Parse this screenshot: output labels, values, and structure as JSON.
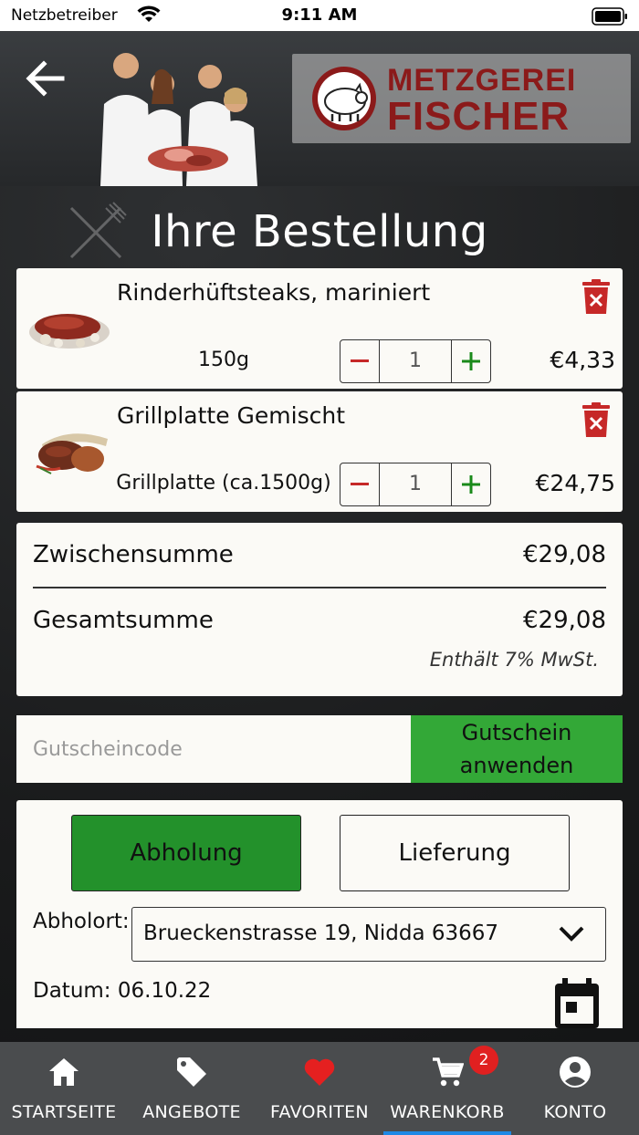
{
  "status_bar": {
    "carrier": "Netzbetreiber",
    "time": "9:11 AM"
  },
  "header": {
    "brand_line1": "METZGEREI",
    "brand_line2": "FISCHER"
  },
  "page_title": "Ihre Bestellung",
  "cart_items": [
    {
      "name": "Rinderhüftsteaks, mariniert",
      "variant": "150g",
      "quantity": "1",
      "price": "€4,33"
    },
    {
      "name": "Grillplatte Gemischt",
      "variant": "Grillplatte (ca.1500g)",
      "quantity": "1",
      "price": "€24,75"
    }
  ],
  "totals": {
    "subtotal_label": "Zwischensumme",
    "subtotal_value": "€29,08",
    "total_label": "Gesamtsumme",
    "total_value": "€29,08",
    "vat_note": "Enthält 7% MwSt."
  },
  "coupon": {
    "placeholder": "Gutscheincode",
    "button_label": "Gutschein\nanwenden"
  },
  "delivery": {
    "pickup_label": "Abholung",
    "delivery_label": "Lieferung",
    "location_label": "Abholort:",
    "location_value": "Brueckenstrasse 19, Nidda 63667",
    "date_label": "Datum: 06.10.22"
  },
  "tabbar": {
    "tabs": [
      {
        "label": "STARTSEITE",
        "icon": "home-icon"
      },
      {
        "label": "ANGEBOTE",
        "icon": "tag-icon"
      },
      {
        "label": "FAVORITEN",
        "icon": "heart-icon"
      },
      {
        "label": "WARENKORB",
        "icon": "cart-icon",
        "badge": "2",
        "active": true
      },
      {
        "label": "KONTO",
        "icon": "account-icon"
      }
    ]
  },
  "colors": {
    "accent_green": "#33a837",
    "selected_green": "#23912b",
    "brand_red": "#8b1a1a",
    "delete_red": "#c62828",
    "active_tab": "#1e88e5"
  }
}
